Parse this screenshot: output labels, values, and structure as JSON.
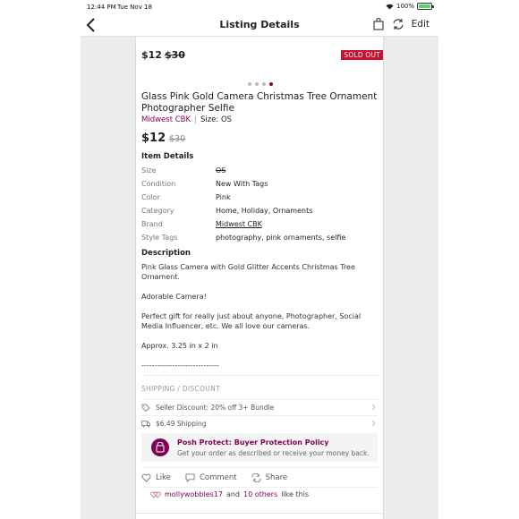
{
  "status_bar": {
    "time": "12:44 PM",
    "date": "Tue Nov 18",
    "battery": "100%"
  },
  "nav": {
    "title": "Listing Details",
    "edit_label": "Edit"
  },
  "hero": {
    "price": "$12",
    "original_price": "$30",
    "sold_badge": "SOLD OUT",
    "image_count": 4,
    "active_image": 4
  },
  "listing": {
    "title": "Glass Pink Gold Camera Christmas Tree Ornament Photographer Selfie",
    "brand": "Midwest CBK",
    "size_label": "Size: OS",
    "price": "$12",
    "original_price": "$30"
  },
  "item_details": {
    "heading": "Item Details",
    "rows": [
      {
        "key": "Size",
        "value": "OS"
      },
      {
        "key": "Condition",
        "value": "New With Tags"
      },
      {
        "key": "Color",
        "value": "Pink"
      },
      {
        "key": "Category",
        "value": "Home, Holiday, Ornaments"
      },
      {
        "key": "Brand",
        "value": "Midwest CBK"
      },
      {
        "key": "Style Tags",
        "value": "photography, pink ornaments, selfie"
      }
    ]
  },
  "description": {
    "heading": "Description",
    "paragraphs": [
      "Pink Glass Camera with Gold Glitter Accents Christmas Tree Ornament.",
      "Adorable Camera!",
      "Perfect gift for really just about anyone, Photographer, Social Media Influencer, etc.    We all love our cameras.",
      "Approx. 3.25 in x 2 in",
      "------------------------------"
    ]
  },
  "shipping": {
    "heading": "SHIPPING / DISCOUNT",
    "discount": "Seller Discount: 20% off 3+ Bundle",
    "shipping": "$6.49 Shipping"
  },
  "posh_protect": {
    "title": "Posh Protect: Buyer Protection Policy",
    "subtitle": "Get your order as described or receive your money back."
  },
  "actions": {
    "like": "Like",
    "comment": "Comment",
    "share": "Share"
  },
  "likes": {
    "user": "mollywobbles17",
    "and": "and",
    "others": "10 others",
    "suffix": "like this"
  },
  "colors": {
    "accent": "#7f0353",
    "sold": "#c8102e"
  }
}
